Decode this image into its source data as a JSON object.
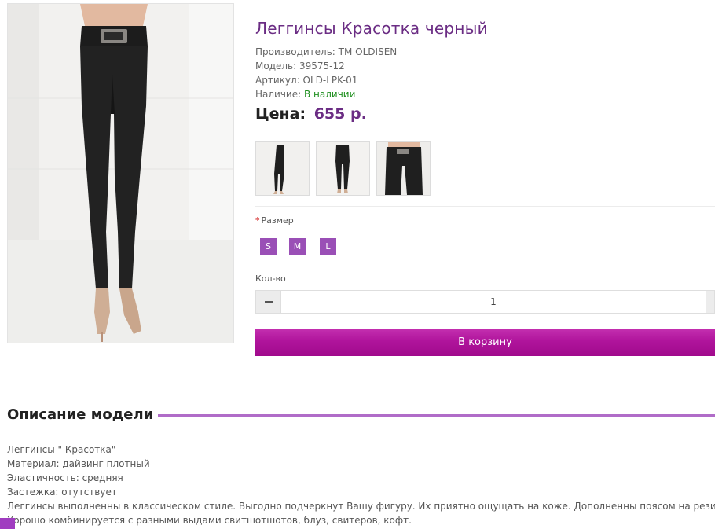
{
  "product": {
    "title": "Леггинсы Красотка черный",
    "manufacturer_label": "Производитель:",
    "manufacturer_value": "TM OLDISEN",
    "model_label": "Модель:",
    "model_value": "39575-12",
    "sku_label": "Артикул:",
    "sku_value": "OLD-LPK-01",
    "availability_label": "Наличие:",
    "availability_value": "В наличии",
    "price_label": "Цена:",
    "price_value": "655 р."
  },
  "options": {
    "required_mark": "*",
    "size_label": "Размер",
    "sizes": [
      "S",
      "M",
      "L"
    ]
  },
  "quantity": {
    "label": "Кол-во",
    "value": "1"
  },
  "cart": {
    "button_label": "В корзину"
  },
  "description": {
    "heading": "Описание модели",
    "lines": [
      "Леггинсы \" Красотка\"",
      "Материал: дайвинг плотный",
      "Эластичность: средняя",
      "Застежка: отутствует",
      "Леггинсы выполненны в классическом стиле. Выгодно подчеркнут Вашу фигуру. Их приятно ощущать на коже. Дополненны поясом на резинке.",
      "Хорошо комбинируется с разными выдами свитшотшотов, блуз, свитеров, кофт."
    ]
  },
  "colors": {
    "title": "#6b2d84",
    "price": "#6b2d84",
    "in_stock": "#1f8f1f",
    "size_button": "#9a4fb6",
    "cart_button": "#b0149c",
    "heading_rule": "#b06cc8"
  }
}
